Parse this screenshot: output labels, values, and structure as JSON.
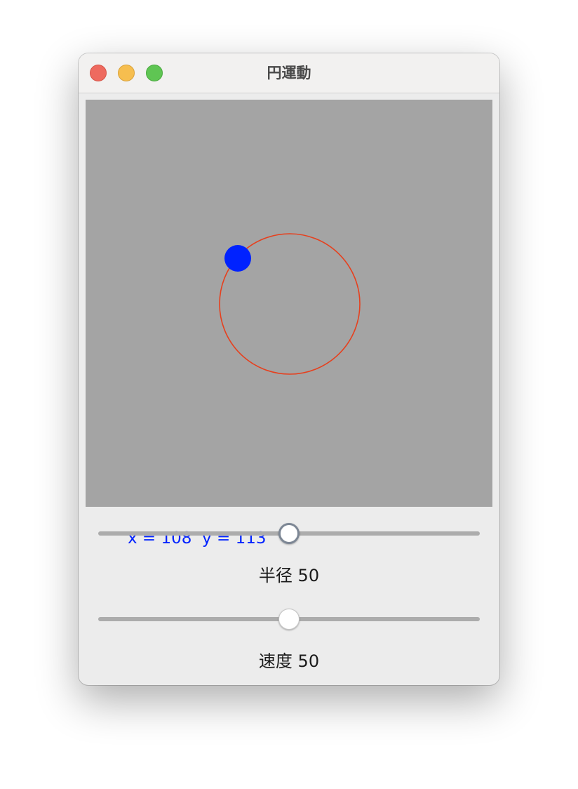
{
  "window": {
    "title": "円運動"
  },
  "canvas": {
    "background": "#a4a4a4",
    "orbit_color": "#e6401e",
    "ball_color": "#0022ff",
    "coords": {
      "x_label": "x = ",
      "x_value": "108",
      "y_label": "y = ",
      "y_value": "113"
    }
  },
  "controls": {
    "radius": {
      "label": "半径",
      "value": "50",
      "position": 0.5
    },
    "speed": {
      "label": "速度",
      "value": "50",
      "position": 0.5
    }
  }
}
